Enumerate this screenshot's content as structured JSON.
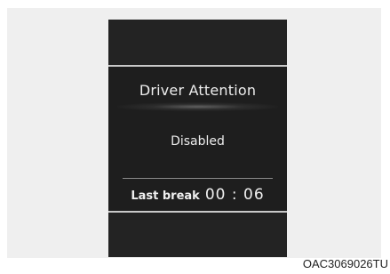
{
  "cluster_display": {
    "title": "Driver Attention",
    "status": "Disabled",
    "last_break_label": "Last break",
    "last_break_time": "00 : 06"
  },
  "figure_code": "OAC3069026TU",
  "colors": {
    "background": "#efefef",
    "display": "#232323",
    "text": "#ededed",
    "separator": "#c9c9c9"
  }
}
